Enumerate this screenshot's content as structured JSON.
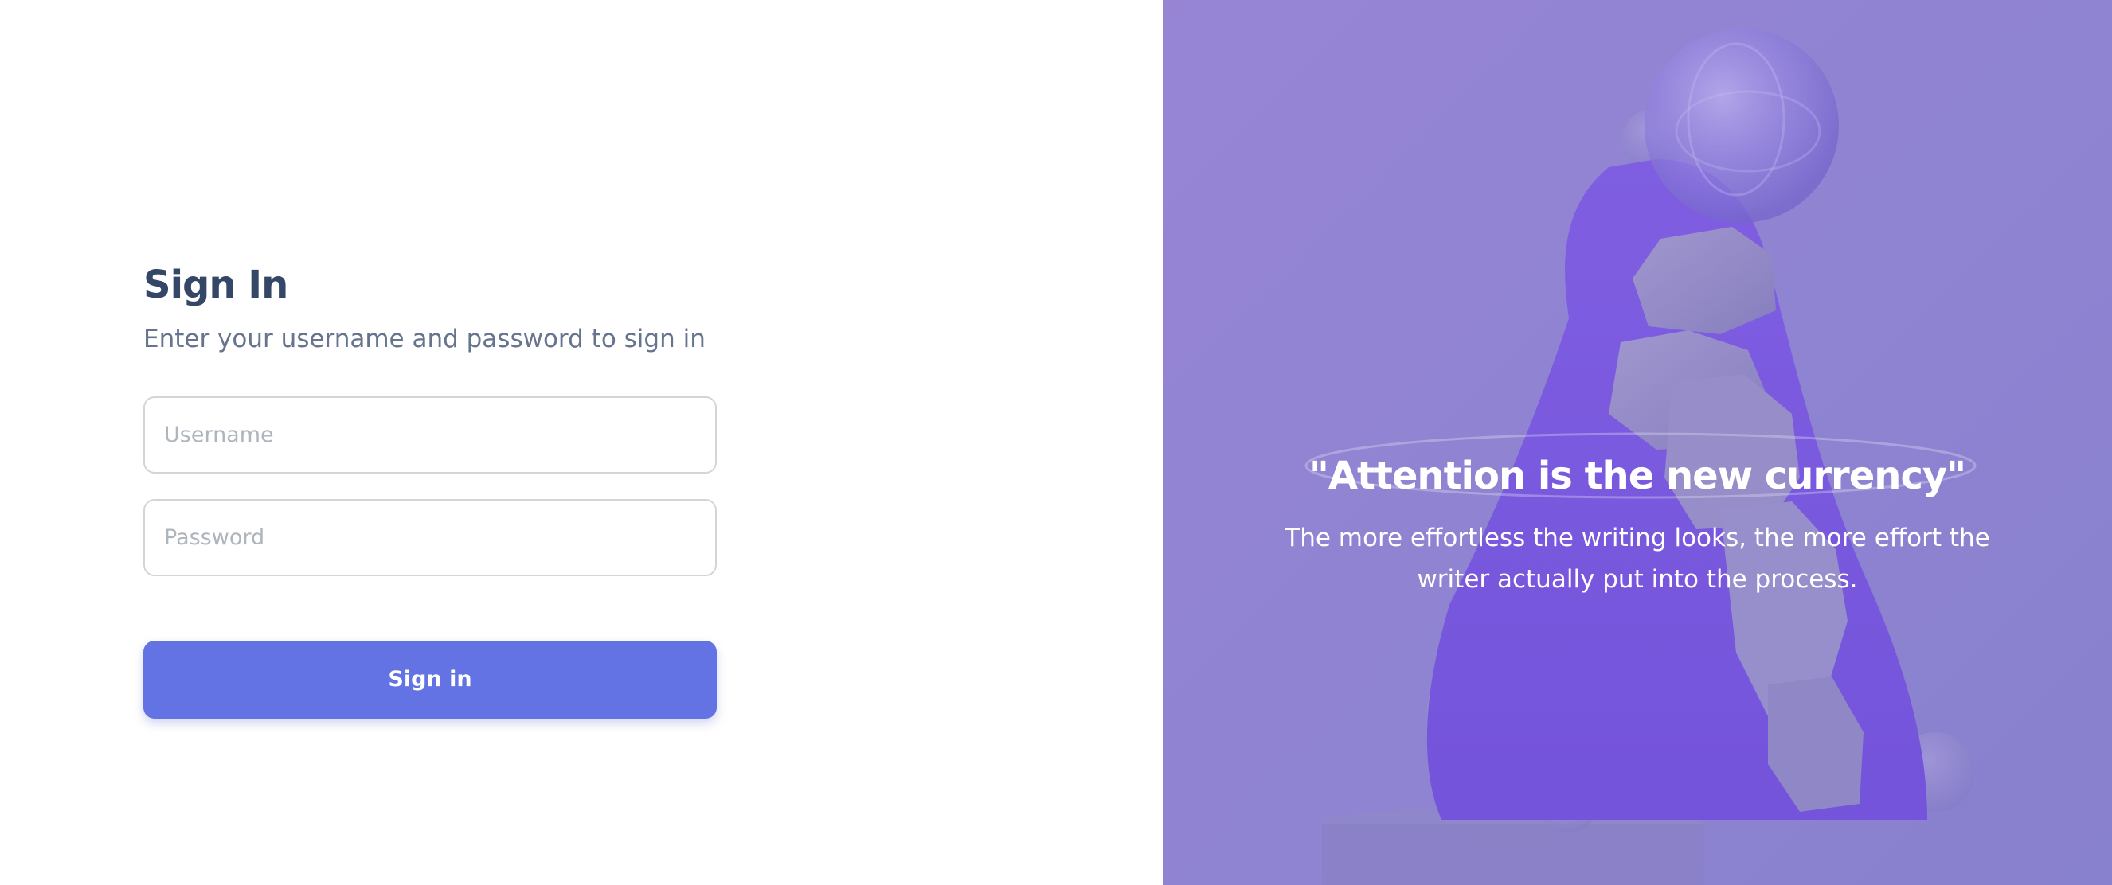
{
  "signin": {
    "title": "Sign In",
    "subtitle": "Enter your username and password to sign in",
    "username_placeholder": "Username",
    "password_placeholder": "Password",
    "submit_label": "Sign in"
  },
  "hero": {
    "quote": "\"Attention is the new currency\"",
    "text": "The more effortless the writing looks, the more effort the writer actually put into the process."
  },
  "colors": {
    "primary": "#6373e3",
    "heading": "#344767",
    "muted": "#67748e",
    "hero_overlay": "#8f84d2"
  }
}
